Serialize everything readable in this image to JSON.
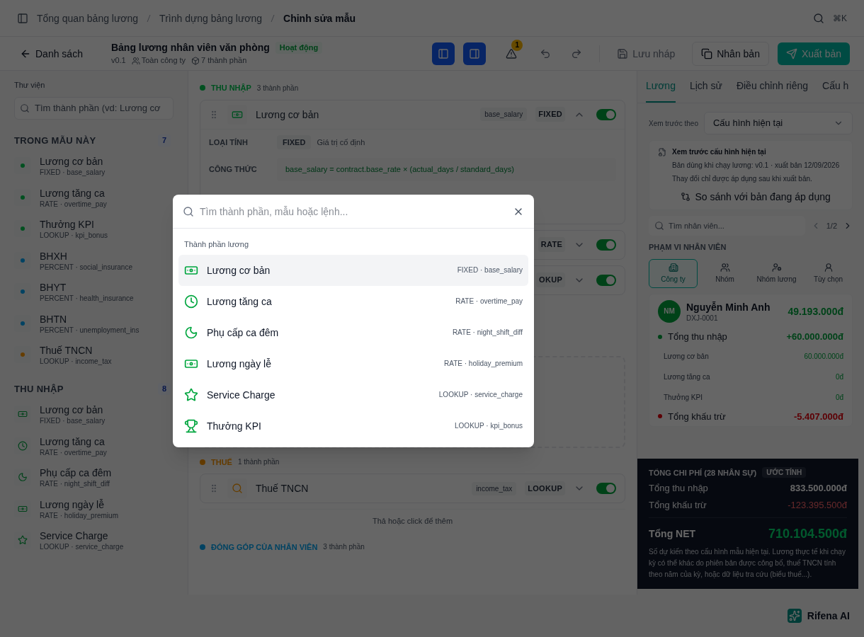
{
  "breadcrumb": [
    {
      "label": "Tổng quan bảng lương",
      "current": false
    },
    {
      "label": "Trình dựng bảng lương",
      "current": false
    },
    {
      "label": "Chỉnh sửa mẫu",
      "current": true
    }
  ],
  "shortcut": "⌘K",
  "header": {
    "back": "Danh sách",
    "title": "Bảng lương nhân viên văn phòng",
    "status": "Hoạt động",
    "version": "v0.1",
    "scope": "Toàn công ty",
    "components": "7 thành phần",
    "panels": [
      {
        "kind": "left",
        "selected": true
      },
      {
        "kind": "right",
        "selected": true
      }
    ],
    "warnings": "1",
    "save": {
      "label": "Lưu nháp",
      "disabled": true
    },
    "duplicate": "Nhân bản",
    "publish": "Xuất bản"
  },
  "sidebar": {
    "label": "Thư viện",
    "search": {
      "placeholder": "Tìm thành phần (vd: Lương cơ"
    },
    "sections": [
      {
        "title": "TRONG MẪU NÀY",
        "count": "7",
        "kind": "dots",
        "items": [
          {
            "name": "Lương cơ bản",
            "meta": "FIXED · base_salary",
            "kind": "income"
          },
          {
            "name": "Lương tăng ca",
            "meta": "RATE · overtime_pay",
            "kind": "income"
          },
          {
            "name": "Thưởng KPI",
            "meta": "LOOKUP · kpi_bonus",
            "kind": "income"
          },
          {
            "name": "BHXH",
            "meta": "PERCENT · social_insurance",
            "kind": "contribution"
          },
          {
            "name": "BHYT",
            "meta": "PERCENT · health_insurance",
            "kind": "contribution"
          },
          {
            "name": "BHTN",
            "meta": "PERCENT · unemployment_ins",
            "kind": "contribution"
          },
          {
            "name": "Thuế TNCN",
            "meta": "LOOKUP · income_tax",
            "kind": "tax"
          }
        ]
      },
      {
        "title": "THU NHẬP",
        "count": "8",
        "kind": "icons",
        "items": [
          {
            "name": "Lương cơ bản",
            "meta": "FIXED · base_salary"
          },
          {
            "name": "Lương tăng ca",
            "meta": "RATE · overtime_pay"
          },
          {
            "name": "Phụ cấp ca đêm",
            "meta": "RATE · night_shift_diff"
          },
          {
            "name": "Lương ngày lễ",
            "meta": "RATE · holiday_premium"
          },
          {
            "name": "Service Charge",
            "meta": "LOOKUP · service_charge"
          }
        ]
      }
    ]
  },
  "canvas": {
    "groups": [
      {
        "title": "THU NHẬP",
        "count": "3 thành phần",
        "kind": "income",
        "rows": [
          {
            "name": "Lương cơ bản",
            "code": "base_salary",
            "badge": "FIXED",
            "expanded": true,
            "on": true,
            "details": {
              "type_label": "LOẠI TÍNH",
              "type": "FIXED",
              "type_desc": "Giá trị cố định",
              "formula_label": "CÔNG THỨC",
              "formula": "base_salary = contract.base_rate × (actual_days / standard_days)"
            }
          },
          {
            "badge": "RATE",
            "expanded": false,
            "on": true
          },
          {
            "badge": "OKUP",
            "expanded": false,
            "on": true
          }
        ],
        "dropzone": true
      },
      {
        "title": "THUẾ",
        "count": "1 thành phần",
        "kind": "tax",
        "rows": [
          {
            "name": "Thuế TNCN",
            "code": "income_tax",
            "badge": "LOOKUP",
            "expanded": false,
            "on": true
          }
        ],
        "hint": "Thả hoặc click để thêm"
      },
      {
        "title": "ĐÓNG GÓP CỦA NHÂN VIÊN",
        "count": "3 thành phần",
        "kind": "contribution"
      }
    ]
  },
  "preview": {
    "tabs": [
      {
        "label": "Lương",
        "selected": true
      },
      {
        "label": "Lịch sử",
        "selected": false
      },
      {
        "label": "Điều chỉnh riêng",
        "selected": false
      },
      {
        "label": "Cấu h",
        "selected": false
      }
    ],
    "select_label": "Xem trước theo",
    "select_value": "Cấu hình hiện tại",
    "info": {
      "title": "Xem trước cấu hình hiện tại",
      "lines": [
        "Bản dùng khi chạy lương: v0.1 · xuất bản 12/09/2026",
        "Thay đổi chỉ được áp dụng sau khi xuất bản."
      ]
    },
    "compare": "So sánh với bản đang áp dụng",
    "employee_search": {
      "placeholder": "Tìm nhân viên..."
    },
    "pager": "1/2",
    "scope_title": "PHẠM VI NHÂN VIÊN",
    "scopes": [
      {
        "label": "Công ty",
        "selected": true
      },
      {
        "label": "Nhóm",
        "selected": false
      },
      {
        "label": "Nhóm lương",
        "selected": false
      },
      {
        "label": "Tùy chọn",
        "selected": false
      }
    ],
    "employee": {
      "initials": "NM",
      "name": "Nguyễn Minh Anh",
      "id": "DXJ-0001",
      "net": "49.193.000đ",
      "income_label": "Tổng thu nhập",
      "income": "+60.000.000đ",
      "items": [
        {
          "label": "Lương cơ bản",
          "value": "60.000.000đ"
        },
        {
          "label": "Lương tăng ca",
          "value": "0đ"
        },
        {
          "label": "Thưởng KPI",
          "value": "0đ"
        }
      ],
      "deduct_label": "Tổng khấu trừ",
      "deduct": "-5.407.000đ"
    },
    "totals": {
      "title": "TỔNG CHI PHÍ (28 NHÂN SỰ)",
      "badge": "ƯỚC TÍNH",
      "income_label": "Tổng thu nhập",
      "income": "833.500.000đ",
      "deduct_label": "Tổng khấu trừ",
      "deduct": "-123.395.500đ",
      "net_label": "Tổng NET",
      "net": "710.104.500đ",
      "note": "Số dự kiến theo cấu hình mẫu hiện tại. Lương thực tế khi chạy kỳ có thể khác do phiên bản được công bố, thuế TNCN tính theo năm của kỳ, hoặc dữ liệu tra cứu (biểu thuế...)."
    }
  },
  "assistant": "Rifena AI",
  "palette": {
    "placeholder": "Tìm thành phần, mẫu hoặc lệnh...",
    "group": "Thành phần lương",
    "items": [
      {
        "name": "Lương cơ bản",
        "meta": "FIXED · base_salary",
        "selected": true
      },
      {
        "name": "Lương tăng ca",
        "meta": "RATE · overtime_pay",
        "selected": false
      },
      {
        "name": "Phụ cấp ca đêm",
        "meta": "RATE · night_shift_diff",
        "selected": false
      },
      {
        "name": "Lương ngày lễ",
        "meta": "RATE · holiday_premium",
        "selected": false
      },
      {
        "name": "Service Charge",
        "meta": "LOOKUP · service_charge",
        "selected": false
      },
      {
        "name": "Thưởng KPI",
        "meta": "LOOKUP · kpi_bonus",
        "selected": false
      }
    ]
  }
}
